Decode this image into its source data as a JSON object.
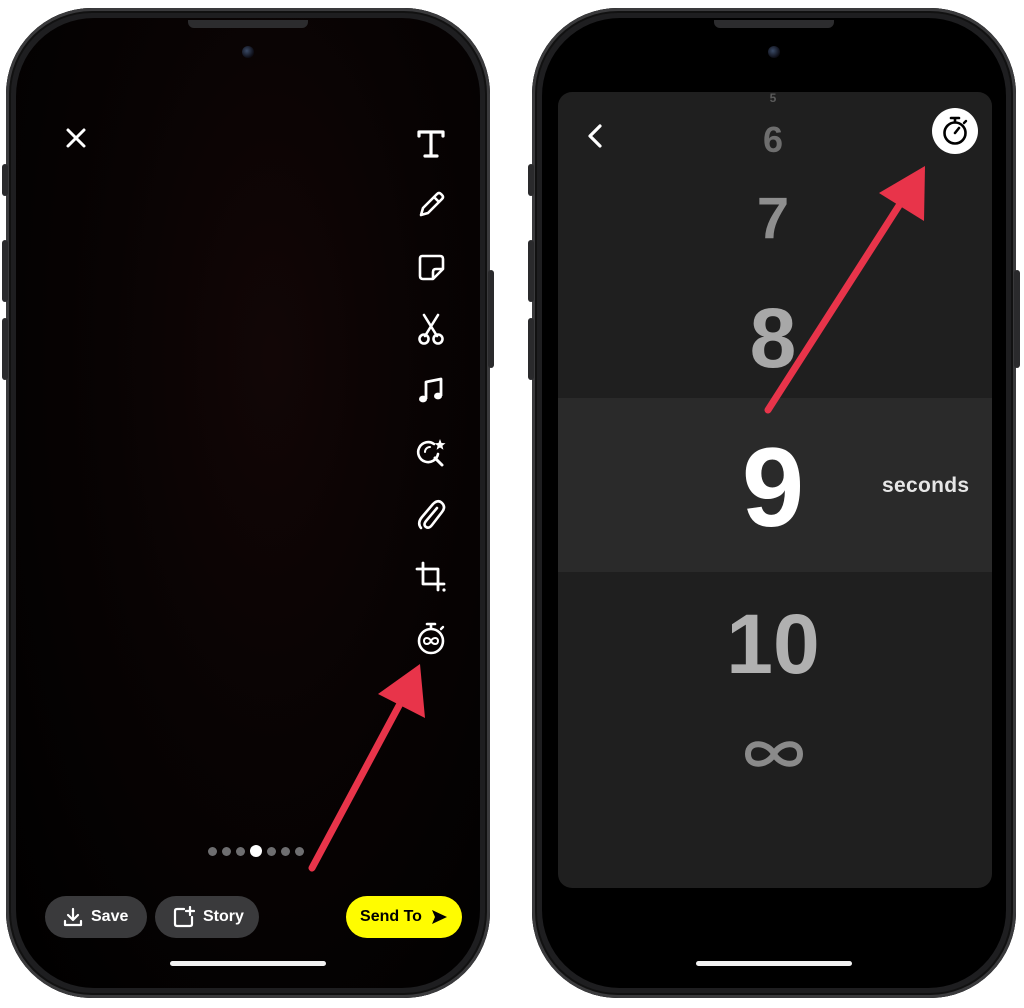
{
  "left_phone": {
    "toolbar": {
      "tools": [
        {
          "icon": "text-icon"
        },
        {
          "icon": "pencil-icon"
        },
        {
          "icon": "sticker-icon"
        },
        {
          "icon": "scissors-icon"
        },
        {
          "icon": "music-note-icon"
        },
        {
          "icon": "lens-search-icon"
        },
        {
          "icon": "paperclip-icon"
        },
        {
          "icon": "crop-icon"
        },
        {
          "icon": "timer-infinity-icon"
        }
      ]
    },
    "page_dots": {
      "count": 7,
      "active_index": 3
    },
    "bottom_bar": {
      "save_label": "Save",
      "story_label": "Story",
      "send_label": "Send To"
    }
  },
  "right_phone": {
    "timer_picker": {
      "options": [
        "5",
        "6",
        "7",
        "8",
        "9",
        "10"
      ],
      "selected": "9",
      "unit_label": "seconds",
      "infinity_option_icon": "infinity-icon"
    }
  },
  "colors": {
    "send_button": "#fffc00",
    "annotation_arrow": "#e8344a",
    "pill_background": "#3a3a3c",
    "panel_background": "#1f1f1f"
  }
}
